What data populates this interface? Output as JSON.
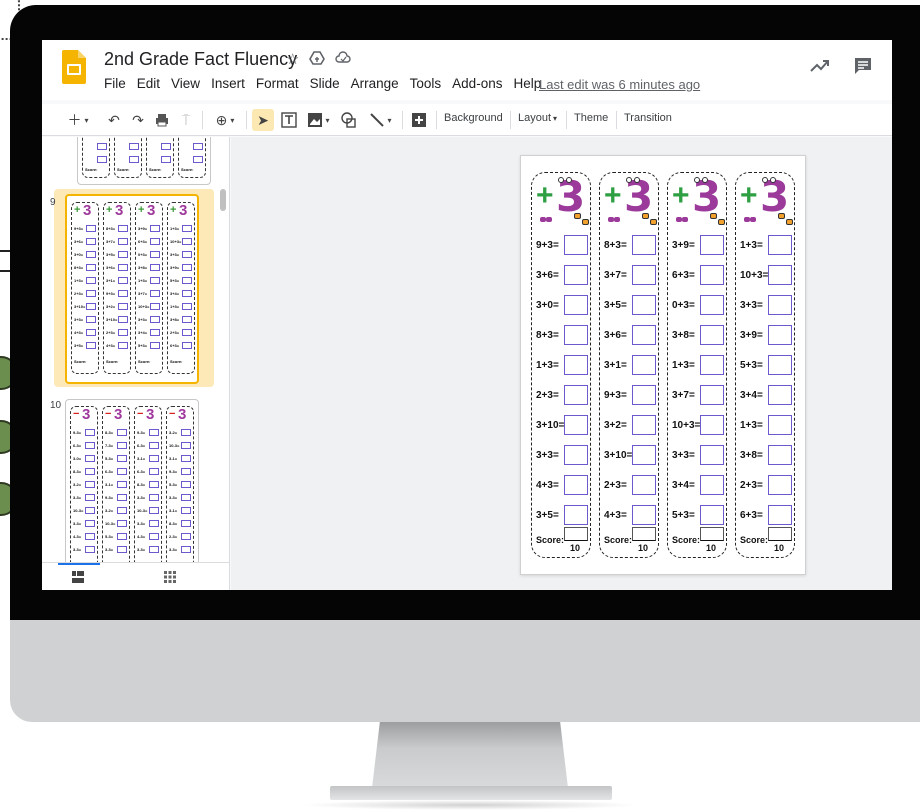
{
  "app": {
    "title": "2nd Grade Fact Fluency",
    "last_edit": "Last edit was 6 minutes ago",
    "menu": [
      "File",
      "Edit",
      "View",
      "Insert",
      "Format",
      "Slide",
      "Arrange",
      "Tools",
      "Add-ons",
      "Help"
    ],
    "title_icons": [
      "star-icon",
      "move-to-drive-icon",
      "cloud-status-icon"
    ],
    "header_right_icons": [
      "activity-trend-icon",
      "comments-icon"
    ]
  },
  "toolbar": {
    "background_label": "Background",
    "layout_label": "Layout",
    "theme_label": "Theme",
    "transition_label": "Transition"
  },
  "filmstrip": {
    "slide_9_number": "9",
    "slide_10_number": "10",
    "view_icons": [
      "filmstrip-view-icon",
      "grid-view-icon"
    ]
  },
  "thumb_9": {
    "columns": [
      [
        "9+3=",
        "3+6=",
        "3+0=",
        "8+3=",
        "1+3=",
        "2+3=",
        "3+10=",
        "3+3=",
        "4+3=",
        "3+5="
      ],
      [
        "8+3=",
        "3+7=",
        "3+5=",
        "3+6=",
        "3+1=",
        "9+3=",
        "3+2=",
        "3+10=",
        "2+3=",
        "4+3="
      ],
      [
        "3+9=",
        "6+3=",
        "0+3=",
        "3+8=",
        "1+3=",
        "3+7=",
        "10+3=",
        "3+3=",
        "3+4=",
        "5+3="
      ],
      [
        "1+3=",
        "10+3=",
        "3+3=",
        "3+9=",
        "5+3=",
        "3+4=",
        "1+3=",
        "3+8=",
        "2+3=",
        "6+3="
      ]
    ]
  },
  "thumb_10": {
    "columns": [
      [
        "9-3=",
        "6-3=",
        "3-0=",
        "8-3=",
        "3-2=",
        "3-3=",
        "10-3=",
        "3-3=",
        "4-3=",
        "3-3="
      ],
      [
        "8-3=",
        "7-3=",
        "5-3=",
        "6-3=",
        "3-1=",
        "9-3=",
        "3-2=",
        "10-3=",
        "5-3=",
        "3-3="
      ],
      [
        "9-3=",
        "6-3=",
        "3-1=",
        "6-3=",
        "8-3=",
        "3-3=",
        "10-3=",
        "3-3=",
        "4-3=",
        "3-3="
      ],
      [
        "3-2=",
        "10-3=",
        "3-1=",
        "9-3=",
        "5-3=",
        "3-3=",
        "3-1=",
        "8-3=",
        "2-3=",
        "3-3="
      ]
    ]
  },
  "slide": {
    "strip_1": [
      "9+3=",
      "3+6=",
      "3+0=",
      "8+3=",
      "1+3=",
      "2+3=",
      "3+10=",
      "3+3=",
      "4+3=",
      "3+5="
    ],
    "strip_2": [
      "8+3=",
      "3+7=",
      "3+5=",
      "3+6=",
      "3+1=",
      "9+3=",
      "3+2=",
      "3+10=",
      "2+3=",
      "4+3="
    ],
    "strip_3": [
      "3+9=",
      "6+3=",
      "0+3=",
      "3+8=",
      "1+3=",
      "3+7=",
      "10+3=",
      "3+3=",
      "3+4=",
      "5+3="
    ],
    "strip_4": [
      "1+3=",
      "10+3=",
      "3+3=",
      "3+9=",
      "5+3=",
      "3+4=",
      "1+3=",
      "3+8=",
      "2+3=",
      "6+3="
    ],
    "score_label": "Score:",
    "score_total": "10",
    "plus": "+",
    "minus": "−",
    "digit": "3"
  },
  "colors": {
    "accent_selected": "#f4b400",
    "plus_green": "#2ea043",
    "minus_red": "#d62020",
    "three_purple": "#9b3a9a"
  }
}
